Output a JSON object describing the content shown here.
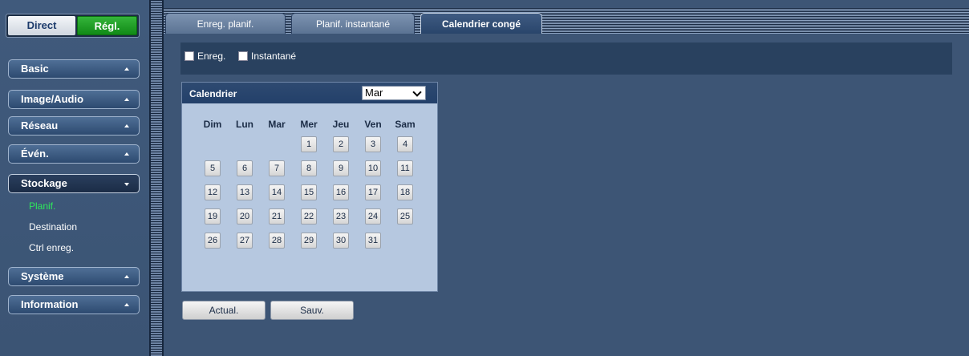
{
  "mode_toggle": {
    "direct": "Direct",
    "regl": "Régl."
  },
  "menu": {
    "basic": "Basic",
    "image_audio": "Image/Audio",
    "reseau": "Réseau",
    "even": "Évén.",
    "stockage": "Stockage",
    "stockage_items": [
      "Planif.",
      "Destination",
      "Ctrl enreg."
    ],
    "systeme": "Système",
    "information": "Information"
  },
  "tabs": [
    "Enreg. planif.",
    "Planif. instantané",
    "Calendrier congé"
  ],
  "active_tab": "Calendrier congé",
  "type_checkboxes": [
    "Enreg.",
    "Instantané"
  ],
  "calendar": {
    "title": "Calendrier",
    "month": "Mar",
    "weekdays": [
      "Dim",
      "Lun",
      "Mar",
      "Mer",
      "Jeu",
      "Ven",
      "Sam"
    ],
    "first_weekday_index": 3,
    "days_in_month": 31
  },
  "buttons": {
    "refresh": "Actual.",
    "save": "Sauv."
  },
  "colors": {
    "background": "#3d5575",
    "accent_green": "#2ee85c",
    "regl_button": "#1fa125"
  }
}
